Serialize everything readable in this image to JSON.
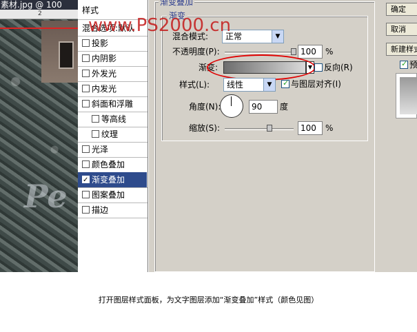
{
  "photo": {
    "title": "素材.jpg @ 100",
    "ruler_number": "2",
    "overlay_text": "Pe"
  },
  "watermark": "www.PS2000.cn",
  "style_list": {
    "header": "样式",
    "blend_options": "混合选项:默认",
    "items": [
      {
        "label": "投影",
        "checked": false,
        "indent": false
      },
      {
        "label": "内阴影",
        "checked": false,
        "indent": false
      },
      {
        "label": "外发光",
        "checked": false,
        "indent": false
      },
      {
        "label": "内发光",
        "checked": false,
        "indent": false
      },
      {
        "label": "斜面和浮雕",
        "checked": false,
        "indent": false
      },
      {
        "label": "等高线",
        "checked": false,
        "indent": true
      },
      {
        "label": "纹理",
        "checked": false,
        "indent": true
      },
      {
        "label": "光泽",
        "checked": false,
        "indent": false
      },
      {
        "label": "颜色叠加",
        "checked": false,
        "indent": false
      },
      {
        "label": "渐变叠加",
        "checked": true,
        "indent": false,
        "selected": true
      },
      {
        "label": "图案叠加",
        "checked": false,
        "indent": false
      },
      {
        "label": "描边",
        "checked": false,
        "indent": false
      }
    ]
  },
  "panel": {
    "group_title": "渐变叠加",
    "sub_title": "渐变",
    "blend_mode_label": "混合模式:",
    "blend_mode_value": "正常",
    "opacity_label": "不透明度(P):",
    "opacity_value": "100",
    "opacity_percent": 100,
    "gradient_label": "渐变:",
    "reverse_label": "反向(R)",
    "reverse_checked": false,
    "style_label": "样式(L):",
    "style_value": "线性",
    "align_label": "与图层对齐(I)",
    "align_checked": true,
    "angle_label": "角度(N):",
    "angle_value": "90",
    "angle_unit": "度",
    "scale_label": "缩放(S):",
    "scale_value": "100",
    "scale_percent": 100,
    "percent_sign": "%"
  },
  "buttons": {
    "ok": "确定",
    "cancel": "取消",
    "new_style": "新建样式...",
    "preview_label": "预览"
  },
  "caption": "打开图层样式面板，为文字图层添加“渐变叠加”样式（颜色见图）",
  "colors": {
    "selected_row": "#2e4b8c",
    "highlight_oval": "#e00000",
    "watermark": "#c41a1a",
    "group_title": "#2f3f8f"
  }
}
